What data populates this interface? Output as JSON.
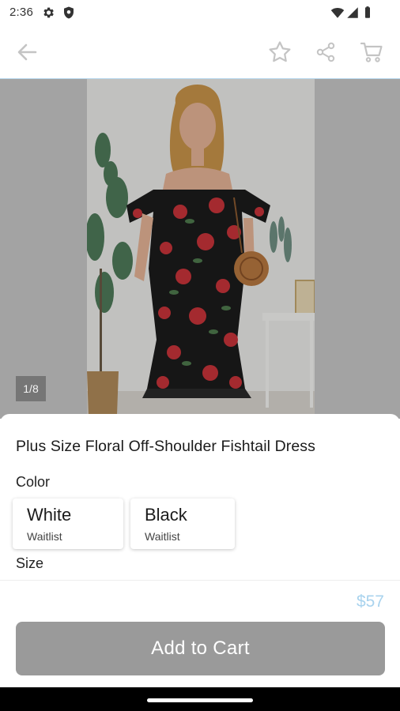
{
  "status_bar": {
    "time": "2:36",
    "icons": [
      "settings-icon",
      "shield-icon",
      "wifi-icon",
      "signal-icon",
      "battery-icon"
    ]
  },
  "app_bar": {
    "icons": [
      "back-arrow-icon",
      "star-icon",
      "share-icon",
      "cart-icon"
    ],
    "icon_color": "#c4c4c4"
  },
  "gallery": {
    "image_counter": "1/8"
  },
  "product": {
    "title": "Plus Size Floral Off-Shoulder Fishtail Dress",
    "color_label": "Color",
    "colors": [
      {
        "name": "White",
        "status": "Waitlist"
      },
      {
        "name": "Black",
        "status": "Waitlist"
      }
    ],
    "size_label": "Size",
    "price": "$57",
    "price_color": "#a9d3ee"
  },
  "actions": {
    "add_to_cart_label": "Add to Cart",
    "button_color": "#9a9a9a"
  }
}
